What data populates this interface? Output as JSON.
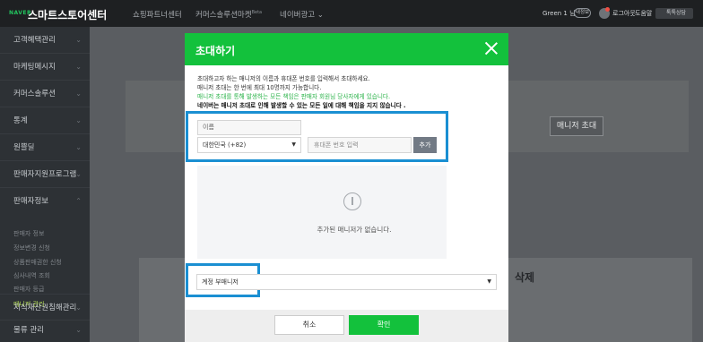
{
  "topbar": {
    "brand_small": "NAVER",
    "brand": "스마트스토어센터",
    "nav": [
      {
        "label": "쇼핑파트너센터"
      },
      {
        "label": "커머스솔루션마켓",
        "badge": "Beta"
      },
      {
        "label": "네이버광고 ⌄"
      }
    ],
    "user": "Green 1 님",
    "user_pill": "내정보",
    "logout": "로그아웃",
    "help": "도움말",
    "messages": "톡톡상담"
  },
  "sidebar": {
    "items": [
      {
        "label": "고객혜택관리"
      },
      {
        "label": "마케팅메시지"
      },
      {
        "label": "커머스솔루션"
      },
      {
        "label": "통계"
      },
      {
        "label": "원쁠딜"
      },
      {
        "label": "판매자지원프로그램"
      },
      {
        "label": "판매자정보"
      }
    ],
    "subitems": [
      {
        "label": "판매자 정보"
      },
      {
        "label": "정보변경 신청"
      },
      {
        "label": "상품판매권한 신청"
      },
      {
        "label": "심사내역 조회"
      },
      {
        "label": "판매자 등급"
      },
      {
        "label": "매니저 관리"
      }
    ],
    "bottom_items": [
      {
        "label": "지식재산권침해관리"
      },
      {
        "label": "물류 관리"
      }
    ]
  },
  "main": {
    "manager_invite_button": "매니저 초대",
    "delete_column": "삭제"
  },
  "modal": {
    "title": "초대하기",
    "desc": [
      "초대하고자 하는 매니저의 이름과 휴대폰 번호를 입력해서 초대하세요.",
      "매니저 초대는 한 번에 최대 10명까지 가능합니다.",
      "매니저 초대를 통해 발생하는 모든 책임은 판매자 회원님 당사자에게 있습니다.",
      "네이버는 매니저 초대로 인해 발생할 수 있는 모든 일에 대해 책임을 지지 않습니다 ."
    ],
    "name_placeholder": "이름",
    "country": "대한민국 (+82)",
    "phone_placeholder": "휴대폰 번호 입력",
    "add_button": "추가",
    "empty_text": "추가된 매니저가 없습니다.",
    "role": "계정 부매니저",
    "cancel": "취소",
    "confirm": "확인"
  },
  "colors": {
    "accent": "#13c13c",
    "highlight": "#1a8fd2"
  }
}
